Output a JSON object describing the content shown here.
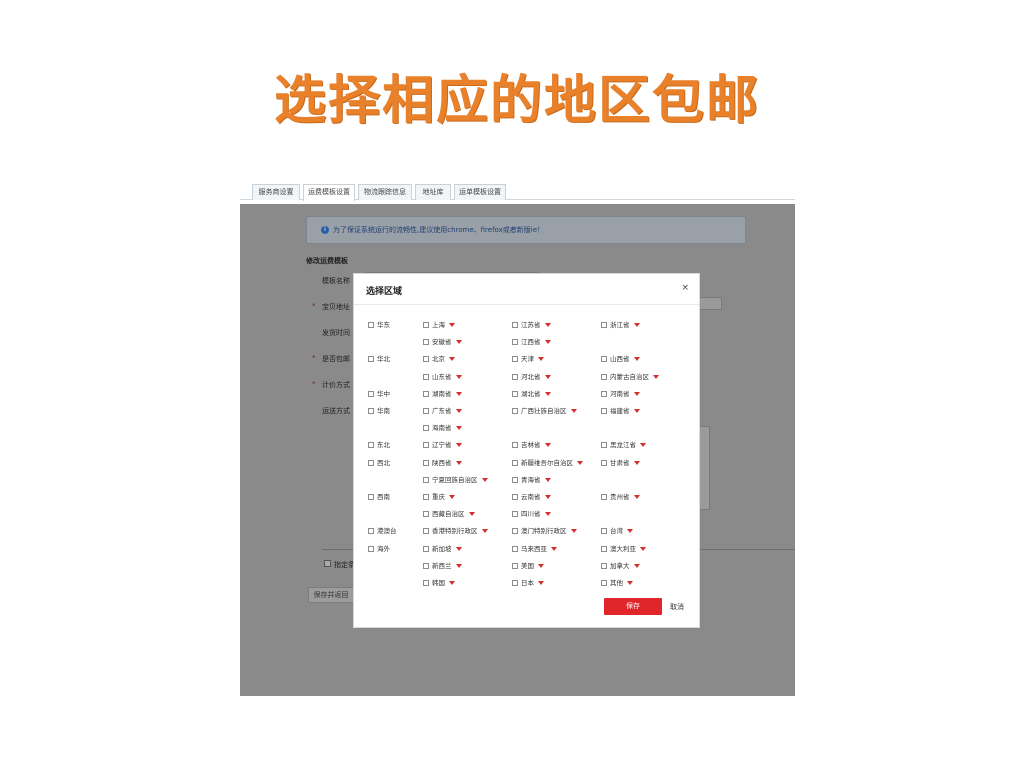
{
  "slide": {
    "title": "选择相应的地区包邮"
  },
  "tabs": [
    "服务商设置",
    "运费模板设置",
    "物流跟踪信息",
    "地址库",
    "运单模板设置"
  ],
  "notice": {
    "text": "为了保证系统运行的流畅性,建议使用chrome、firefox或者新版ie！"
  },
  "background_form": {
    "section_title": "修改运费模板",
    "labels": [
      "模板名称",
      "宝贝地址",
      "发货时间",
      "是否包邮",
      "计价方式",
      "运送方式"
    ],
    "bottom_check_label": "指定条",
    "save_return_label": "保存并返回"
  },
  "modal": {
    "title": "选择区域",
    "close": "×",
    "save_label": "保存",
    "cancel_label": "取消",
    "regions": [
      {
        "label": "华东",
        "row": 0
      },
      {
        "label": "华北",
        "row": 2
      },
      {
        "label": "华中",
        "row": 4
      },
      {
        "label": "华南",
        "row": 5
      },
      {
        "label": "东北",
        "row": 7
      },
      {
        "label": "西北",
        "row": 8
      },
      {
        "label": "西南",
        "row": 10
      },
      {
        "label": "港澳台",
        "row": 12
      },
      {
        "label": "海外",
        "row": 13
      }
    ],
    "provinces": [
      {
        "label": "上海",
        "row": 0,
        "col": 0
      },
      {
        "label": "江苏省",
        "row": 0,
        "col": 1
      },
      {
        "label": "浙江省",
        "row": 0,
        "col": 2
      },
      {
        "label": "安徽省",
        "row": 1,
        "col": 0
      },
      {
        "label": "江西省",
        "row": 1,
        "col": 1
      },
      {
        "label": "北京",
        "row": 2,
        "col": 0
      },
      {
        "label": "天津",
        "row": 2,
        "col": 1
      },
      {
        "label": "山西省",
        "row": 2,
        "col": 2
      },
      {
        "label": "山东省",
        "row": 3,
        "col": 0
      },
      {
        "label": "河北省",
        "row": 3,
        "col": 1
      },
      {
        "label": "内蒙古自治区",
        "row": 3,
        "col": 2
      },
      {
        "label": "湖南省",
        "row": 4,
        "col": 0
      },
      {
        "label": "湖北省",
        "row": 4,
        "col": 1
      },
      {
        "label": "河南省",
        "row": 4,
        "col": 2
      },
      {
        "label": "广东省",
        "row": 5,
        "col": 0
      },
      {
        "label": "广西壮族自治区",
        "row": 5,
        "col": 1
      },
      {
        "label": "福建省",
        "row": 5,
        "col": 2
      },
      {
        "label": "海南省",
        "row": 6,
        "col": 0
      },
      {
        "label": "辽宁省",
        "row": 7,
        "col": 0
      },
      {
        "label": "吉林省",
        "row": 7,
        "col": 1
      },
      {
        "label": "黑龙江省",
        "row": 7,
        "col": 2
      },
      {
        "label": "陕西省",
        "row": 8,
        "col": 0
      },
      {
        "label": "新疆维吾尔自治区",
        "row": 8,
        "col": 1
      },
      {
        "label": "甘肃省",
        "row": 8,
        "col": 2
      },
      {
        "label": "宁夏回族自治区",
        "row": 9,
        "col": 0
      },
      {
        "label": "青海省",
        "row": 9,
        "col": 1
      },
      {
        "label": "重庆",
        "row": 10,
        "col": 0
      },
      {
        "label": "云南省",
        "row": 10,
        "col": 1
      },
      {
        "label": "贵州省",
        "row": 10,
        "col": 2
      },
      {
        "label": "西藏自治区",
        "row": 11,
        "col": 0
      },
      {
        "label": "四川省",
        "row": 11,
        "col": 1
      },
      {
        "label": "香港特别行政区",
        "row": 12,
        "col": 0
      },
      {
        "label": "澳门特别行政区",
        "row": 12,
        "col": 1
      },
      {
        "label": "台湾",
        "row": 12,
        "col": 2
      },
      {
        "label": "新加坡",
        "row": 13,
        "col": 0
      },
      {
        "label": "马来西亚",
        "row": 13,
        "col": 1
      },
      {
        "label": "澳大利亚",
        "row": 13,
        "col": 2
      },
      {
        "label": "新西兰",
        "row": 14,
        "col": 0
      },
      {
        "label": "美国",
        "row": 14,
        "col": 1
      },
      {
        "label": "加拿大",
        "row": 14,
        "col": 2
      },
      {
        "label": "韩国",
        "row": 15,
        "col": 0
      },
      {
        "label": "日本",
        "row": 15,
        "col": 1
      },
      {
        "label": "其他",
        "row": 15,
        "col": 2
      }
    ]
  },
  "colors": {
    "title": "#e8812a",
    "save_button": "#e0262a",
    "caret": "#d42f2f",
    "overlay": "#8a8a8a"
  },
  "icons": [
    "info-icon",
    "close-icon",
    "caret-down-icon",
    "checkbox-icon"
  ]
}
